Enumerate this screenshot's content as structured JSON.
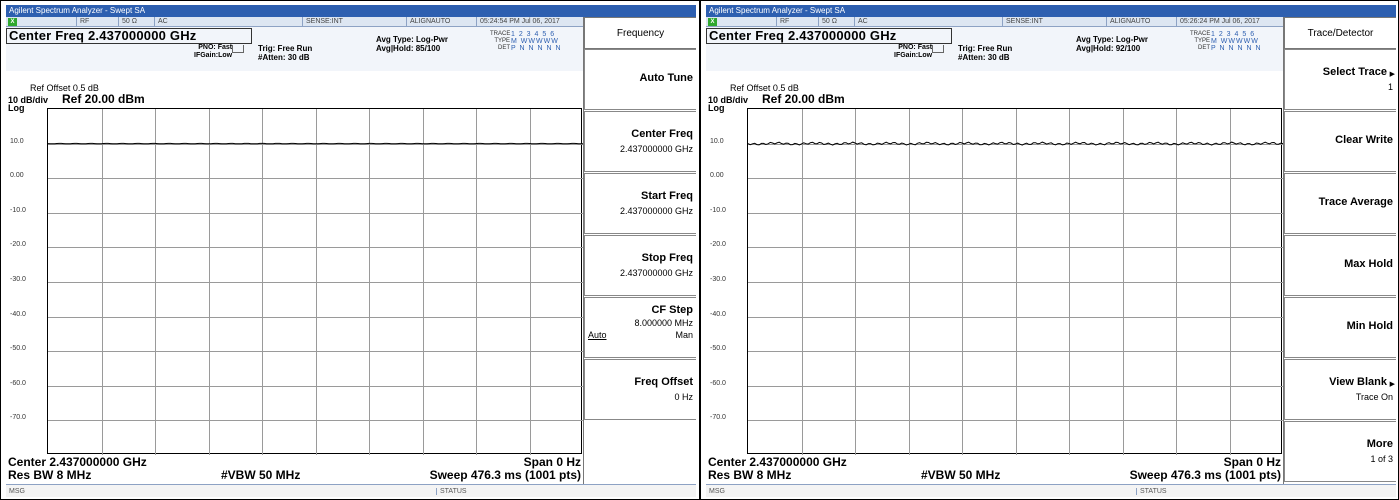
{
  "panels": [
    {
      "title_bar": "Agilent Spectrum Analyzer - Swept SA",
      "status_line": {
        "indicator": "LXI",
        "rf": "RF",
        "impedance": "50 Ω",
        "coupling": "AC",
        "sense": "SENSE:INT",
        "align": "ALIGNAUTO",
        "datetime": "05:24:54 PM Jul 06, 2017"
      },
      "center_freq_title": "Center Freq 2.437000000 GHz",
      "pno": "PNO: Fast",
      "ifgain": "IFGain:Low",
      "trig": "Trig: Free Run",
      "atten": "#Atten: 30 dB",
      "avg_type": "Avg Type: Log-Pwr",
      "avg_hold": "Avg|Hold: 85/100",
      "trace_label": "TRACE",
      "type_label": "TYPE",
      "det_label": "DET",
      "trace_numbers": "1 2 3 4 5 6",
      "trace_type": "M WWWWW",
      "trace_det": "P N N N N N",
      "ref_offset": "Ref Offset 0.5 dB",
      "db_div": "10 dB/div",
      "ref_level": "Ref 20.00 dBm",
      "log": "Log",
      "y_ticks": [
        "10.0",
        "0.00",
        "-10.0",
        "-20.0",
        "-30.0",
        "-40.0",
        "-50.0",
        "-60.0",
        "-70.0"
      ],
      "bottom": {
        "center": "Center 2.437000000 GHz",
        "span": "Span 0 Hz",
        "rbw": "Res BW 8 MHz",
        "vbw": "#VBW 50 MHz",
        "sweep": "Sweep  476.3 ms (1001 pts)"
      },
      "msg": "MSG",
      "status": "STATUS",
      "softkey_title": "Frequency",
      "softkeys": [
        {
          "label": "Auto Tune",
          "sub": ""
        },
        {
          "label": "Center Freq",
          "sub": "2.437000000 GHz"
        },
        {
          "label": "Start Freq",
          "sub": "2.437000000 GHz"
        },
        {
          "label": "Stop Freq",
          "sub": "2.437000000 GHz"
        },
        {
          "label": "CF Step",
          "sub": "8.000000 MHz",
          "auto": "Auto",
          "man": "Man"
        },
        {
          "label": "Freq Offset",
          "sub": "0 Hz"
        }
      ]
    },
    {
      "title_bar": "Agilent Spectrum Analyzer - Swept SA",
      "status_line": {
        "indicator": "LXI",
        "rf": "RF",
        "impedance": "50 Ω",
        "coupling": "AC",
        "sense": "SENSE:INT",
        "align": "ALIGNAUTO",
        "datetime": "05:26:24 PM Jul 06, 2017"
      },
      "center_freq_title": "Center Freq 2.437000000 GHz",
      "pno": "PNO: Fast",
      "ifgain": "IFGain:Low",
      "trig": "Trig: Free Run",
      "atten": "#Atten: 30 dB",
      "avg_type": "Avg Type: Log-Pwr",
      "avg_hold": "Avg|Hold: 92/100",
      "trace_label": "TRACE",
      "type_label": "TYPE",
      "det_label": "DET",
      "trace_numbers": "1 2 3 4 5 6",
      "trace_type": "M WWWWW",
      "trace_det": "P N N N N N",
      "ref_offset": "Ref Offset 0.5 dB",
      "db_div": "10 dB/div",
      "ref_level": "Ref 20.00 dBm",
      "log": "Log",
      "y_ticks": [
        "10.0",
        "0.00",
        "-10.0",
        "-20.0",
        "-30.0",
        "-40.0",
        "-50.0",
        "-60.0",
        "-70.0"
      ],
      "bottom": {
        "center": "Center 2.437000000 GHz",
        "span": "Span 0 Hz",
        "rbw": "Res BW 8 MHz",
        "vbw": "#VBW 50 MHz",
        "sweep": "Sweep  476.3 ms (1001 pts)"
      },
      "msg": "MSG",
      "status": "STATUS",
      "softkey_title": "Trace/Detector",
      "softkeys": [
        {
          "label": "Select Trace",
          "sub": "1",
          "arrow": true
        },
        {
          "label": "Clear Write",
          "sub": ""
        },
        {
          "label": "Trace Average",
          "sub": ""
        },
        {
          "label": "Max Hold",
          "sub": ""
        },
        {
          "label": "Min Hold",
          "sub": ""
        },
        {
          "label": "View Blank",
          "sub": "Trace On",
          "arrow": true
        },
        {
          "label": "More",
          "sub": "1 of 3"
        }
      ]
    }
  ],
  "trace": {
    "level_dbm": 10.0,
    "ref_level_dbm": 20.0,
    "db_per_div": 10,
    "divisions": 10,
    "color": "#000000"
  }
}
